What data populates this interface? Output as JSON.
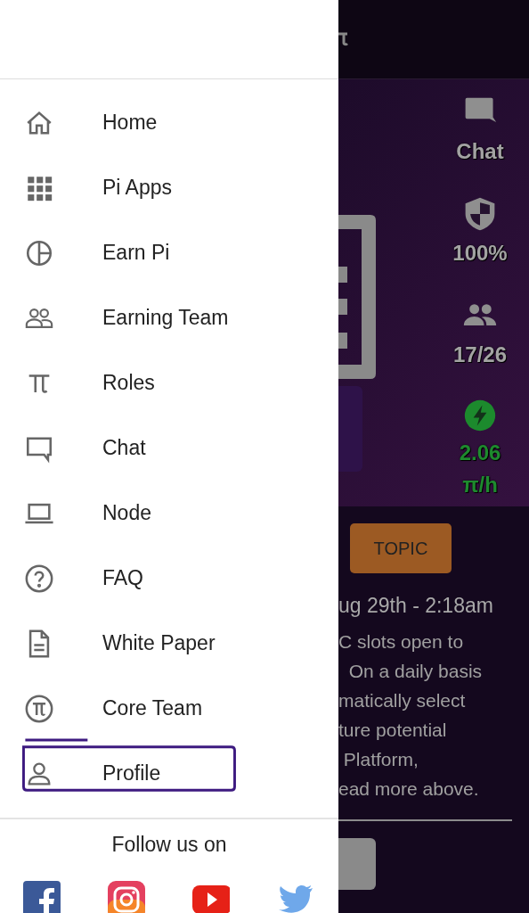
{
  "drawer": {
    "items": [
      {
        "label": "Home",
        "kind": "home",
        "highlighted": false
      },
      {
        "label": "Pi Apps",
        "kind": "apps",
        "highlighted": false
      },
      {
        "label": "Earn Pi",
        "kind": "pie",
        "highlighted": false
      },
      {
        "label": "Earning Team",
        "kind": "team",
        "highlighted": false
      },
      {
        "label": "Roles",
        "kind": "pi",
        "highlighted": false
      },
      {
        "label": "Chat",
        "kind": "chat",
        "highlighted": false
      },
      {
        "label": "Node",
        "kind": "laptop",
        "highlighted": false
      },
      {
        "label": "FAQ",
        "kind": "help",
        "highlighted": false
      },
      {
        "label": "White Paper",
        "kind": "doc",
        "highlighted": false
      },
      {
        "label": "Core Team",
        "kind": "coin",
        "highlighted": false
      },
      {
        "label": "Profile",
        "kind": "person",
        "highlighted": true
      }
    ],
    "footer": {
      "text": "Follow us on",
      "socials": [
        {
          "kind": "facebook"
        },
        {
          "kind": "instagram"
        },
        {
          "kind": "youtube"
        },
        {
          "kind": "twitter"
        }
      ]
    }
  },
  "background": {
    "stats": [
      {
        "kind": "chat",
        "lines": [
          "Chat"
        ]
      },
      {
        "kind": "shield",
        "lines": [
          "100%"
        ]
      },
      {
        "kind": "team",
        "lines": [
          "17/26"
        ]
      },
      {
        "kind": "rate",
        "lines": [
          "2.06",
          "π/h"
        ]
      }
    ],
    "topic_button": "TOPIC",
    "date": "ug 29th - 2:18am",
    "paragraph": [
      "C slots open to",
      "  On a daily basis",
      "matically select",
      "ture potential",
      " Platform,",
      "ead more above."
    ]
  }
}
